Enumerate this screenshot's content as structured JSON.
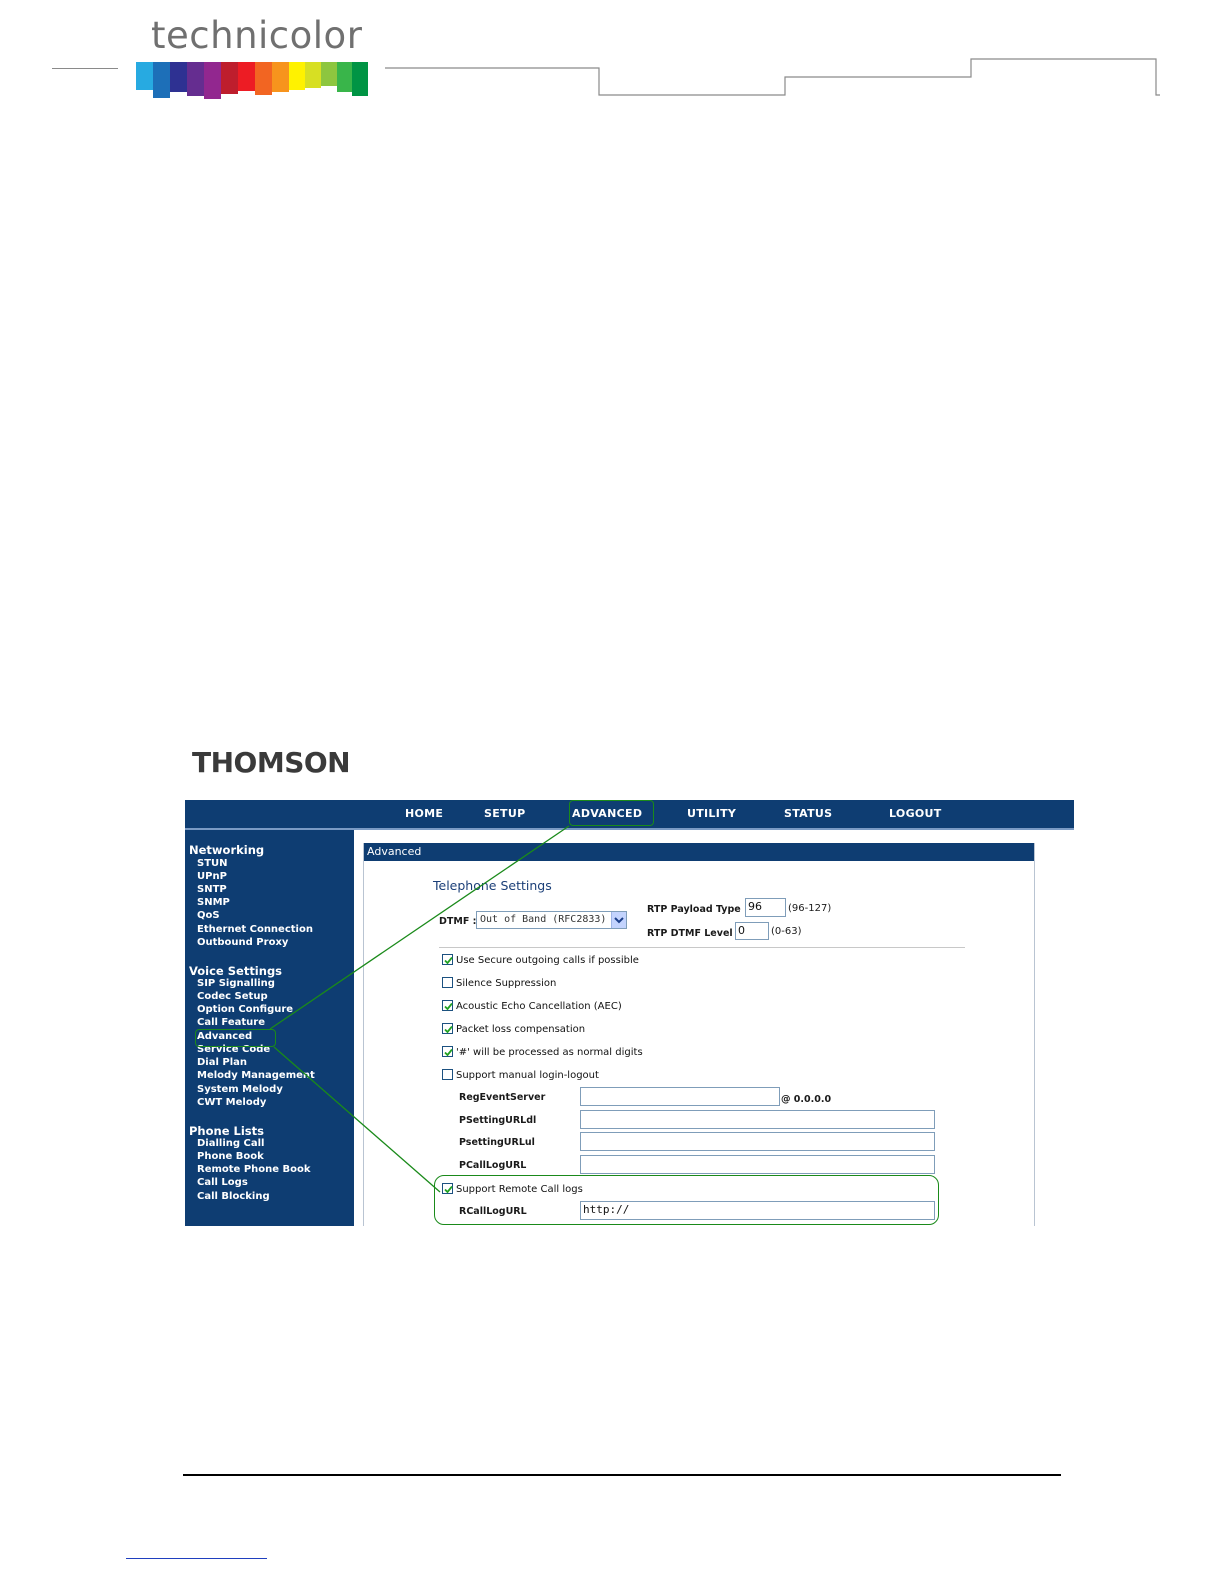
{
  "doc_header": {
    "brand": "technicolor",
    "logo_colors": [
      "#27aae1",
      "#1d6fb8",
      "#2e3192",
      "#652d90",
      "#92278f",
      "#be1e2d",
      "#ed1c24",
      "#f26522",
      "#f7941d",
      "#fff200",
      "#d7df23",
      "#8dc63f",
      "#39b54a",
      "#009444"
    ]
  },
  "thomson_logo": "THOMSON",
  "topnav": {
    "items": [
      "HOME",
      "SETUP",
      "ADVANCED",
      "UTILITY",
      "STATUS",
      "LOGOUT"
    ],
    "active": "ADVANCED"
  },
  "sidebar": {
    "groups": [
      {
        "title": "Networking",
        "items": [
          "STUN",
          "UPnP",
          "SNTP",
          "SNMP",
          "QoS",
          "Ethernet Connection",
          "Outbound Proxy"
        ]
      },
      {
        "title": "Voice Settings",
        "items": [
          "SIP Signalling",
          "Codec Setup",
          "Option Configure",
          "Call Feature",
          "Advanced",
          "Service Code",
          "Dial Plan",
          "Melody Management",
          "System Melody",
          "CWT Melody"
        ]
      },
      {
        "title": "Phone Lists",
        "items": [
          "Dialling Call",
          "Phone Book",
          "Remote Phone Book",
          "Call Logs",
          "Call Blocking"
        ]
      }
    ]
  },
  "panel": {
    "title": "Advanced",
    "section_title": "Telephone Settings",
    "dtmf": {
      "label": "DTMF :",
      "value": "Out of Band (RFC2833)"
    },
    "rtp_payload": {
      "label": "RTP Payload Type :",
      "value": "96",
      "range": "(96-127)"
    },
    "rtp_dtmf": {
      "label": "RTP DTMF Level :",
      "value": "0",
      "range": "(0-63)"
    },
    "checkboxes": [
      {
        "label": "Use Secure outgoing calls if possible",
        "checked": true
      },
      {
        "label": "Silence Suppression",
        "checked": false
      },
      {
        "label": "Acoustic Echo Cancellation (AEC)",
        "checked": true
      },
      {
        "label": "Packet loss compensation",
        "checked": true
      },
      {
        "label": "'#' will be processed as normal digits",
        "checked": true
      },
      {
        "label": "Support manual login-logout",
        "checked": false
      }
    ],
    "fields": {
      "reg_event_server": {
        "label": "RegEventServer",
        "value": "",
        "suffix": "@ 0.0.0.0"
      },
      "psetting_url_dl": {
        "label": "PSettingURLdl",
        "value": ""
      },
      "psetting_url_ul": {
        "label": "PsettingURLul",
        "value": ""
      },
      "pcalllog_url": {
        "label": "PCallLogURL",
        "value": ""
      }
    },
    "remote_call_logs": {
      "label": "Support Remote Call logs",
      "checked": true
    },
    "rcalllog_url": {
      "label": "RCallLogURL",
      "value": "http://"
    }
  },
  "callout_color": "#1a8a1a"
}
